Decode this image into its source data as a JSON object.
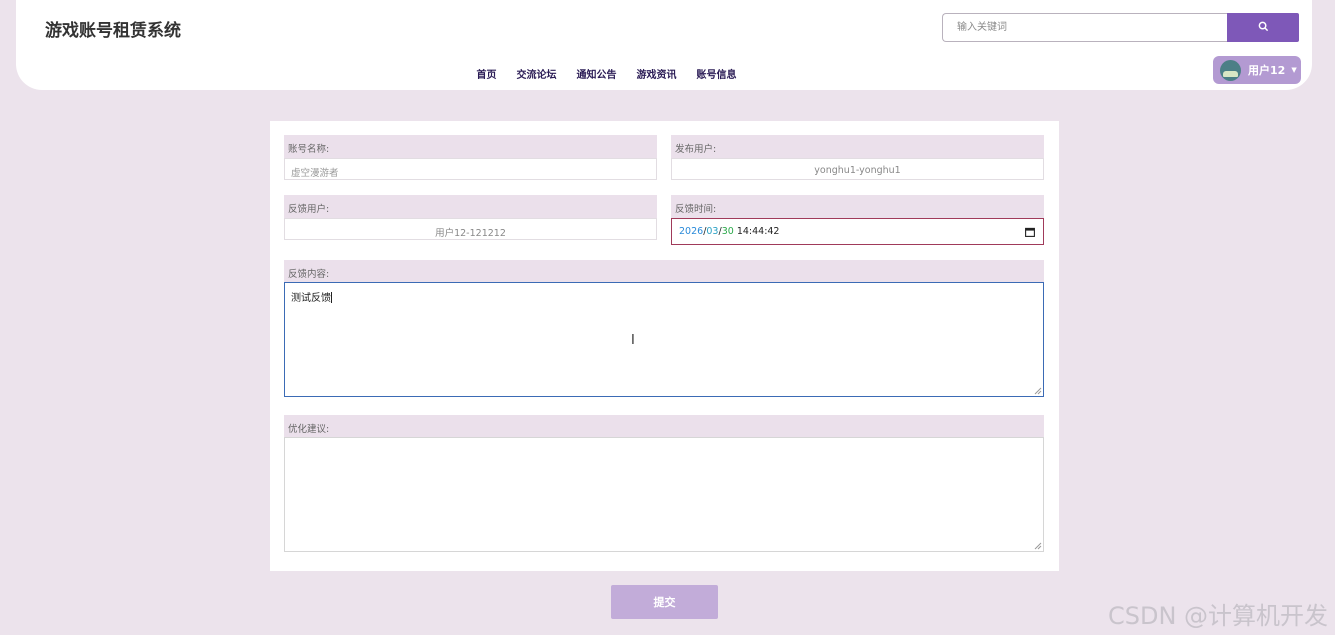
{
  "header": {
    "title": "游戏账号租赁系统",
    "search_placeholder": "输入关键词",
    "nav": [
      "首页",
      "交流论坛",
      "通知公告",
      "游戏资讯",
      "账号信息"
    ],
    "user_name": "用户12"
  },
  "form": {
    "account_name": {
      "label": "账号名称:",
      "placeholder": "虚空漫游者"
    },
    "publisher": {
      "label": "发布用户:",
      "value": "yonghu1-yonghu1"
    },
    "feedback_user": {
      "label": "反馈用户:",
      "value": "用户12-121212"
    },
    "feedback_time": {
      "label": "反馈时间:",
      "year": "2026",
      "month": "03",
      "day": "30",
      "time": "14:44:42"
    },
    "feedback_content": {
      "label": "反馈内容:",
      "value": "测试反馈"
    },
    "suggestion": {
      "label": "优化建议:",
      "value": ""
    }
  },
  "submit_label": "提交",
  "watermark": "CSDN @计算机开发",
  "colors": {
    "accent": "#7e58b8",
    "user_button": "#b39ad2",
    "submit": "#c2acd9",
    "background": "#ece3ec"
  }
}
